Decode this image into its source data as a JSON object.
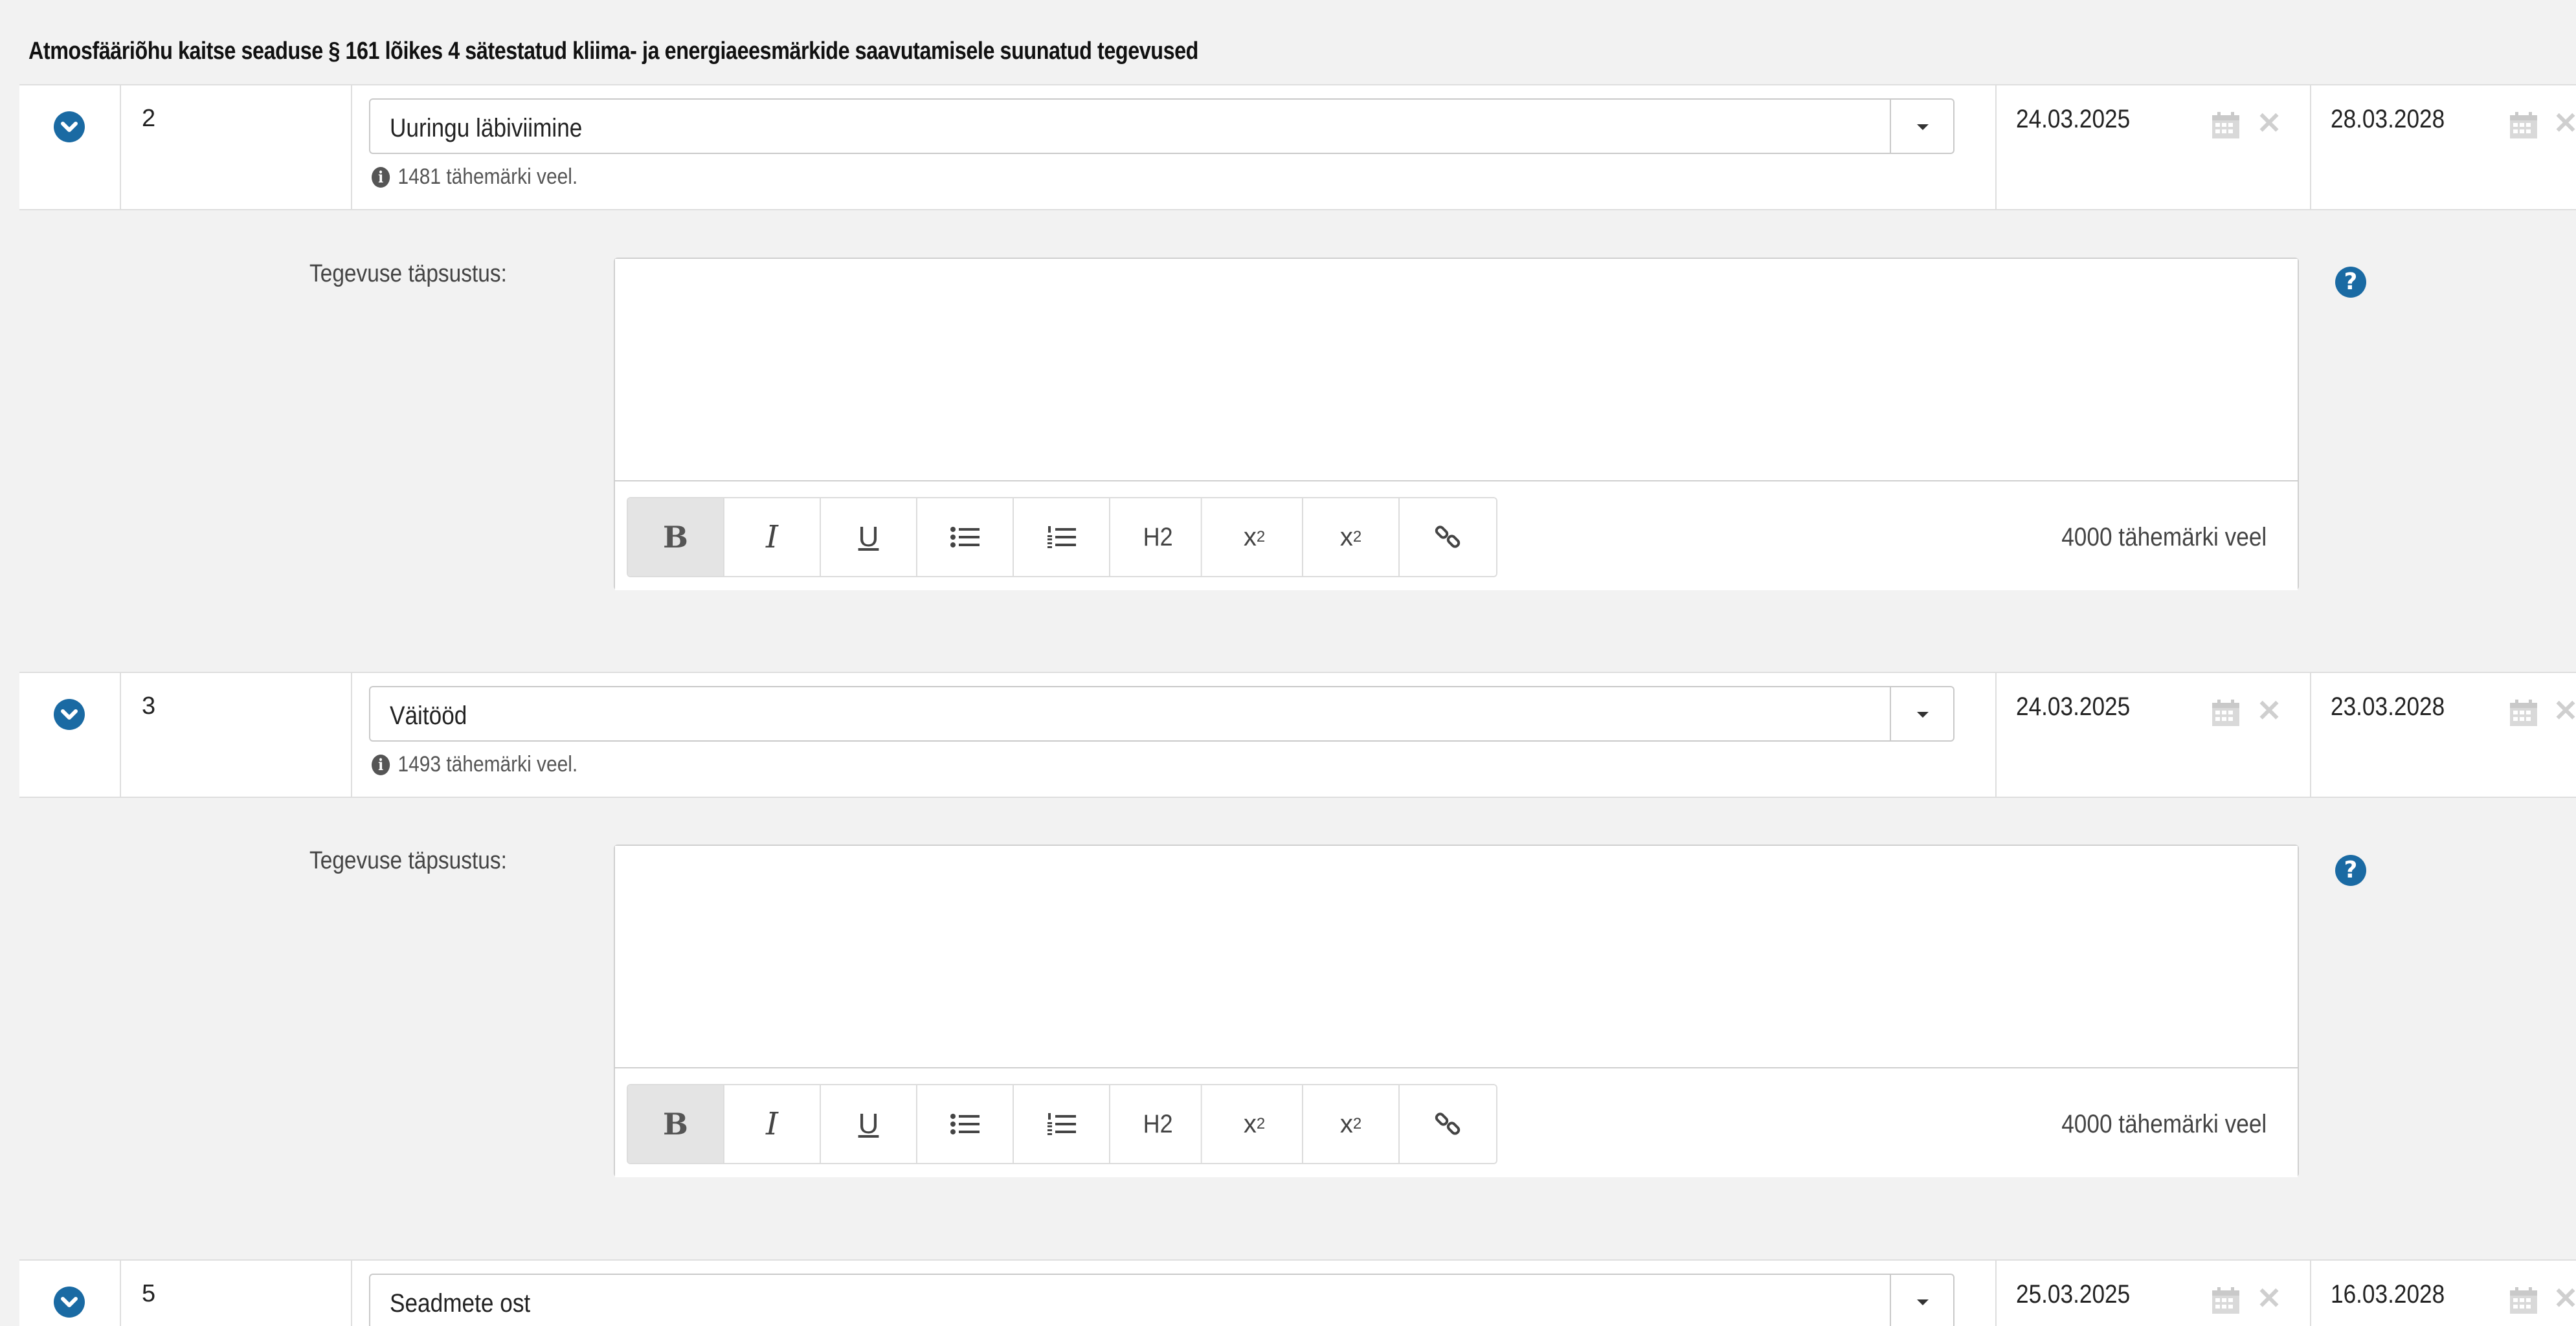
{
  "section": {
    "title": "Atmosfääriõhu kaitse seaduse § 161 lõikes 4 sätestatud kliima- ja energiaeesmärkide saavutamisele suunatud tegevused"
  },
  "activities": [
    {
      "number": "2",
      "activity": "Uuringu läbiviimine",
      "chars_left": "1481 tähemärki veel.",
      "start_date": "24.03.2025",
      "end_date": "28.03.2028",
      "detail_label": "Tegevuse täpsustus:",
      "detail_text": "",
      "editor_chars_left": "4000 tähemärki veel"
    },
    {
      "number": "3",
      "activity": "Väitööd",
      "chars_left": "1493 tähemärki veel.",
      "start_date": "24.03.2025",
      "end_date": "23.03.2028",
      "detail_label": "Tegevuse täpsustus:",
      "detail_text": "",
      "editor_chars_left": "4000 tähemärki veel"
    },
    {
      "number": "5",
      "activity": "Seadmete ost",
      "start_date": "25.03.2025",
      "end_date": "16.03.2028"
    }
  ],
  "toolbar": {
    "bold": "B",
    "italic": "I",
    "underline": "U",
    "h2": "H2"
  },
  "icons": {
    "toggle": "chevron-down-circle-icon",
    "info": "info-circle-icon",
    "calendar": "calendar-icon",
    "clear": "times-icon",
    "help": "question-circle-icon"
  },
  "colors": {
    "accent": "#1a6aa3",
    "background": "#f2f2f2",
    "border": "#dedede"
  }
}
